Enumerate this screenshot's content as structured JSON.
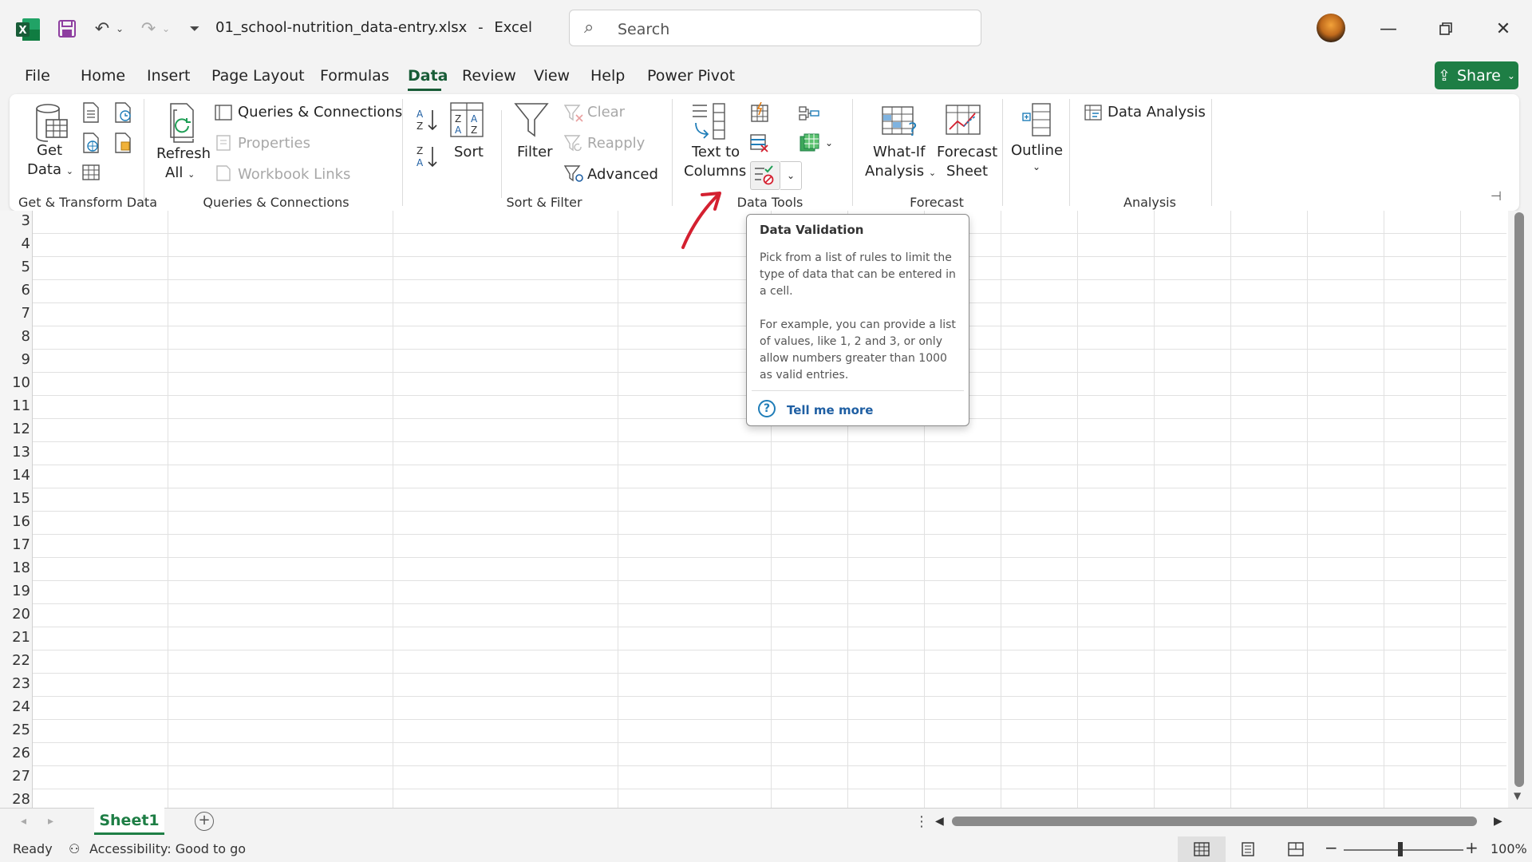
{
  "window": {
    "filename": "01_school-nutrition_data-entry.xlsx",
    "app_name": "Excel",
    "title_separator": "-",
    "search_placeholder": "Search"
  },
  "menu_tabs": [
    "File",
    "Home",
    "Insert",
    "Page Layout",
    "Formulas",
    "Data",
    "Review",
    "View",
    "Help",
    "Power Pivot"
  ],
  "active_tab": "Data",
  "share_label": "Share",
  "ribbon": {
    "get_transform": {
      "get_data": "Get",
      "get_data_2": "Data",
      "group_label": "Get & Transform Data"
    },
    "queries": {
      "refresh": "Refresh",
      "refresh_2": "All",
      "queries_connections": "Queries & Connections",
      "properties": "Properties",
      "workbook_links": "Workbook Links",
      "group_label": "Queries & Connections"
    },
    "sort_filter": {
      "sort": "Sort",
      "filter": "Filter",
      "clear": "Clear",
      "reapply": "Reapply",
      "advanced": "Advanced",
      "group_label": "Sort & Filter"
    },
    "data_tools": {
      "text_to_columns": "Text to",
      "text_to_columns_2": "Columns",
      "group_label": "Data Tools"
    },
    "forecast": {
      "what_if": "What-If",
      "what_if_2": "Analysis",
      "forecast_sheet": "Forecast",
      "forecast_sheet_2": "Sheet",
      "group_label": "Forecast"
    },
    "outline": {
      "label": "Outline"
    },
    "analysis": {
      "data_analysis": "Data Analysis",
      "group_label": "Analysis"
    }
  },
  "tooltip": {
    "title": "Data Validation",
    "para1": "Pick from a list of rules to limit the type of data that can be entered in a cell.",
    "para2": "For example, you can provide a list of values, like 1, 2 and 3, or only allow numbers greater than 1000 as valid entries.",
    "link": "Tell me more"
  },
  "rows": [
    "3",
    "4",
    "5",
    "6",
    "7",
    "8",
    "9",
    "10",
    "11",
    "12",
    "13",
    "14",
    "15",
    "16",
    "17",
    "18",
    "19",
    "20",
    "21",
    "22",
    "23",
    "24",
    "25",
    "26",
    "27",
    "28"
  ],
  "sheet_tab": "Sheet1",
  "status": {
    "ready": "Ready",
    "accessibility": "Accessibility: Good to go",
    "zoom": "100%"
  },
  "annotation_color": "#d42030",
  "accent_color": "#1e7e45"
}
